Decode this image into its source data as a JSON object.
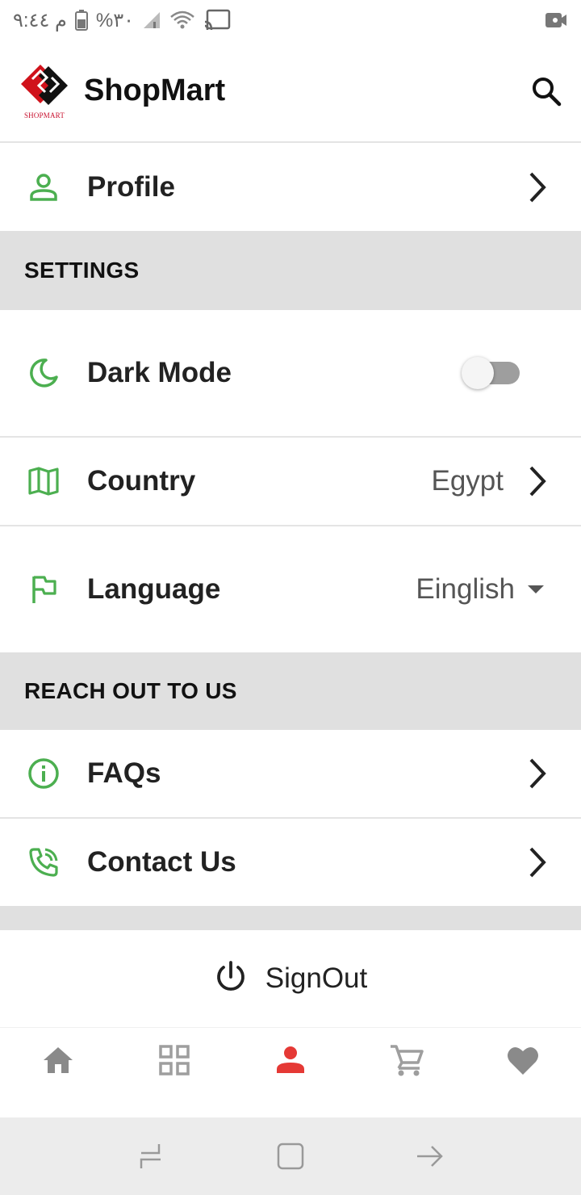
{
  "status_bar": {
    "time": "م ٩:٤٤",
    "battery": "%٣٠",
    "icons": [
      "battery-icon",
      "signal-icon",
      "wifi-icon",
      "cast-icon",
      "video-record-icon"
    ]
  },
  "app_bar": {
    "title": "ShopMart",
    "logo_text": "SHOPMART",
    "icons": [
      "logo-icon",
      "search-icon"
    ]
  },
  "profile": {
    "label": "Profile",
    "icon": "person-icon"
  },
  "settings": {
    "header": "SETTINGS",
    "dark_mode": {
      "label": "Dark Mode",
      "icon": "moon-icon",
      "enabled": false
    },
    "country": {
      "label": "Country",
      "value": "Egypt",
      "icon": "map-icon"
    },
    "language": {
      "label": "Language",
      "value": "Einglish",
      "icon": "flag-icon"
    }
  },
  "reach_out": {
    "header": "REACH OUT TO US",
    "faqs": {
      "label": "FAQs",
      "icon": "info-icon"
    },
    "contact": {
      "label": "Contact Us",
      "icon": "phone-icon"
    }
  },
  "signout": {
    "label": "SignOut",
    "icon": "power-icon"
  },
  "bottom_nav": {
    "items": [
      {
        "name": "home",
        "icon": "home-icon",
        "active": false
      },
      {
        "name": "categories",
        "icon": "grid-icon",
        "active": false
      },
      {
        "name": "profile",
        "icon": "person-icon",
        "active": true
      },
      {
        "name": "cart",
        "icon": "cart-icon",
        "active": false
      },
      {
        "name": "favorites",
        "icon": "heart-icon",
        "active": false
      }
    ]
  },
  "colors": {
    "accent_green": "#4caf50",
    "active_red": "#e53935",
    "section_bg": "#e0e0e0",
    "inactive_icon": "#9e9e9e"
  }
}
